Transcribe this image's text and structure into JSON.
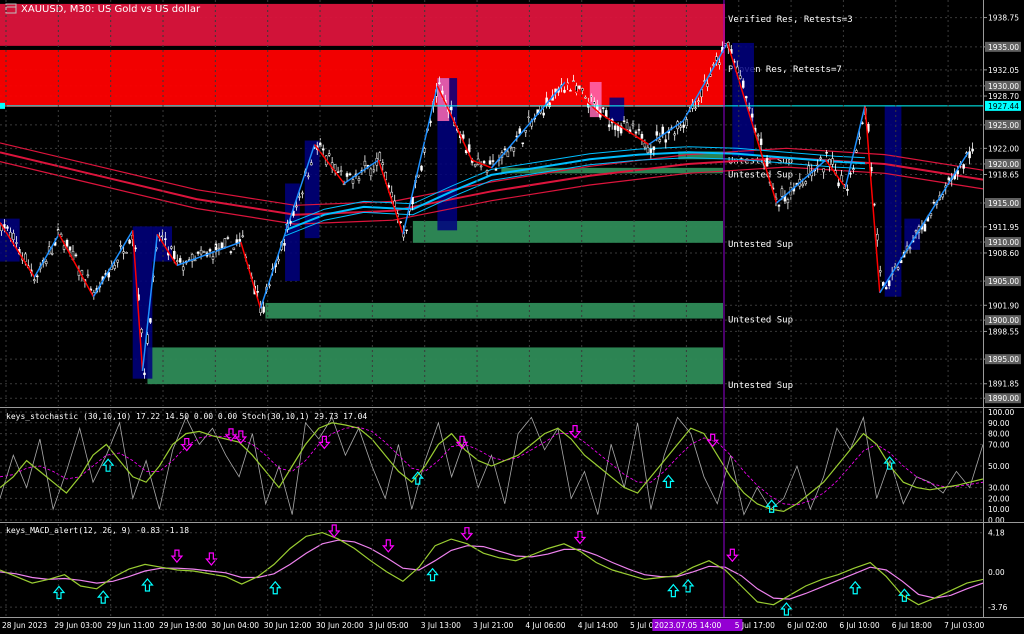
{
  "window": {
    "title": "XAUUSD, M30:  US Gold vs US dollar",
    "icon": "chart-window-icon"
  },
  "colors": {
    "background": "#000000",
    "grid": "#3a3a3a",
    "bull": "#ffffff",
    "bear": "#ffffff",
    "res_verified": "#dc143c",
    "res_proven": "#ff0000",
    "support_untested": "#2e8b57",
    "zigzag_up": "#1e90ff",
    "zigzag_down": "#ff0000",
    "ema_red": "#dc143c",
    "ema_blue": "#00bfff",
    "bid_line": "#00ffff",
    "period_separator": "#9400d3",
    "axis_text": "#ffffff",
    "stoch_main": "#9acd32",
    "stoch_signal": "#ff00ff",
    "stoch_fast": "#a9a9a9",
    "macd_main": "#9acd32",
    "macd_signal": "#ee82ee",
    "arrow_buy": "#00ffff",
    "arrow_sell": "#ff00ff"
  },
  "zones": {
    "labels": [
      "Verified Res, Retests=3",
      "Proven Res, Retests=7",
      "Untested Sup",
      "Untested Sup",
      "Untested Sup",
      "Untested Sup",
      "Untested Sup"
    ],
    "items": [
      {
        "kind": "verified_res",
        "label_index": 0,
        "low": 1935.0,
        "high": 1940.5,
        "x_from": 0.0,
        "x_to": 1.0
      },
      {
        "kind": "proven_res",
        "label_index": 1,
        "low": 1927.3,
        "high": 1934.6,
        "x_from": 0.0,
        "x_to": 1.0
      },
      {
        "kind": "untested_sup",
        "label_index": 2,
        "low": 1920.6,
        "high": 1921.6,
        "x_from": 0.69,
        "x_to": 1.0
      },
      {
        "kind": "untested_sup",
        "label_index": 3,
        "low": 1918.8,
        "high": 1919.5,
        "x_from": 0.51,
        "x_to": 1.0
      },
      {
        "kind": "untested_sup",
        "label_index": 4,
        "low": 1909.9,
        "high": 1912.7,
        "x_from": 0.42,
        "x_to": 1.0
      },
      {
        "kind": "untested_sup",
        "label_index": 5,
        "low": 1900.2,
        "high": 1902.2,
        "x_from": 0.27,
        "x_to": 1.0
      },
      {
        "kind": "untested_sup",
        "label_index": 6,
        "low": 1891.8,
        "high": 1896.5,
        "x_from": 0.15,
        "x_to": 1.0
      }
    ]
  },
  "chart_data": [
    {
      "type": "candlestick",
      "title": "XAUUSD, M30:  US Gold vs US dollar",
      "ylim": [
        1889.0,
        1941.0
      ],
      "y_tick_labels": [
        "1938.75",
        "1935.00",
        "1932.05",
        "1930.00",
        "1928.70",
        "1925.00",
        "1922.00",
        "1920.00",
        "1918.65",
        "1915.00",
        "1911.95",
        "1910.00",
        "1908.60",
        "1905.00",
        "1901.90",
        "1900.00",
        "1898.55",
        "1895.00",
        "1891.85",
        "1890.00"
      ],
      "current_price": 1927.44,
      "current_price_label": "1927.44",
      "x_labels": [
        "28 Jun 2023",
        "29 Jun 03:00",
        "29 Jun 11:00",
        "29 Jun 19:00",
        "30 Jun 04:00",
        "30 Jun 12:00",
        "30 Jun 20:00",
        "3 Jul 05:00",
        "3 Jul 13:00",
        "3 Jul 21:00",
        "4 Jul 06:00",
        "4 Jul 14:00",
        "5 Jul 01:00",
        "2023.07.05 14:00",
        "5 Jul 17:00",
        "6 Jul 02:00",
        "6 Jul 10:00",
        "6 Jul 18:00",
        "7 Jul 03:00"
      ],
      "highlighted_x_label_index": 13,
      "zigzag": [
        {
          "x": 0.0,
          "y": 1912.5
        },
        {
          "x": 0.035,
          "y": 1905.5
        },
        {
          "x": 0.06,
          "y": 1911.0
        },
        {
          "x": 0.095,
          "y": 1903.0
        },
        {
          "x": 0.135,
          "y": 1911.5
        },
        {
          "x": 0.145,
          "y": 1893.5
        },
        {
          "x": 0.16,
          "y": 1911.0
        },
        {
          "x": 0.18,
          "y": 1907.0
        },
        {
          "x": 0.245,
          "y": 1910.0
        },
        {
          "x": 0.265,
          "y": 1901.5
        },
        {
          "x": 0.32,
          "y": 1922.5
        },
        {
          "x": 0.35,
          "y": 1917.5
        },
        {
          "x": 0.385,
          "y": 1920.5
        },
        {
          "x": 0.41,
          "y": 1911.0
        },
        {
          "x": 0.445,
          "y": 1930.0
        },
        {
          "x": 0.48,
          "y": 1920.5
        },
        {
          "x": 0.5,
          "y": 1919.5
        },
        {
          "x": 0.575,
          "y": 1930.5
        },
        {
          "x": 0.61,
          "y": 1926.5
        },
        {
          "x": 0.66,
          "y": 1922.5
        },
        {
          "x": 0.695,
          "y": 1925.5
        },
        {
          "x": 0.74,
          "y": 1935.5
        },
        {
          "x": 0.79,
          "y": 1915.0
        },
        {
          "x": 0.84,
          "y": 1920.5
        },
        {
          "x": 0.86,
          "y": 1917.0
        },
        {
          "x": 0.88,
          "y": 1927.5
        },
        {
          "x": 0.895,
          "y": 1903.5
        },
        {
          "x": 0.985,
          "y": 1921.5
        }
      ],
      "ema_red": [
        {
          "x": 0.0,
          "y": 1921.5
        },
        {
          "x": 0.1,
          "y": 1918.5
        },
        {
          "x": 0.2,
          "y": 1915.5
        },
        {
          "x": 0.3,
          "y": 1913.5
        },
        {
          "x": 0.4,
          "y": 1914.0
        },
        {
          "x": 0.5,
          "y": 1916.5
        },
        {
          "x": 0.6,
          "y": 1918.5
        },
        {
          "x": 0.7,
          "y": 1920.0
        },
        {
          "x": 0.8,
          "y": 1920.8
        },
        {
          "x": 0.9,
          "y": 1920.0
        },
        {
          "x": 1.0,
          "y": 1918.0
        }
      ],
      "ema_blue": [
        {
          "x": 0.29,
          "y": 1911.5
        },
        {
          "x": 0.33,
          "y": 1913.5
        },
        {
          "x": 0.37,
          "y": 1914.5
        },
        {
          "x": 0.42,
          "y": 1914.2
        },
        {
          "x": 0.46,
          "y": 1916.5
        },
        {
          "x": 0.5,
          "y": 1918.6
        },
        {
          "x": 0.55,
          "y": 1919.6
        },
        {
          "x": 0.6,
          "y": 1920.6
        },
        {
          "x": 0.65,
          "y": 1921.2
        },
        {
          "x": 0.7,
          "y": 1921.5
        },
        {
          "x": 0.75,
          "y": 1921.3
        },
        {
          "x": 0.8,
          "y": 1920.8
        },
        {
          "x": 0.85,
          "y": 1920.3
        },
        {
          "x": 0.88,
          "y": 1920.1
        }
      ]
    },
    {
      "type": "line",
      "indicator_label": "keys_stochastic (30,10,10) 17.22 14.50 0.00 0.00 Stoch(30,10,1) 29.73 17.04",
      "ylim": [
        0,
        100
      ],
      "y_tick_labels": [
        "100.00",
        "90.00",
        "80.00",
        "70.00",
        "50.00",
        "30.00",
        "20.00",
        "10.00",
        "0.00"
      ],
      "series": [
        {
          "values": [
            30,
            40,
            55,
            45,
            35,
            25,
            40,
            60,
            70,
            55,
            40,
            35,
            50,
            70,
            80,
            82,
            78,
            75,
            72,
            60,
            45,
            30,
            50,
            70,
            85,
            90,
            88,
            85,
            75,
            60,
            45,
            35,
            50,
            70,
            80,
            65,
            55,
            50,
            55,
            60,
            70,
            80,
            85,
            75,
            60,
            50,
            40,
            30,
            25,
            40,
            55,
            70,
            85,
            80,
            60,
            40,
            25,
            15,
            10,
            8,
            15,
            25,
            35,
            50,
            65,
            80,
            70,
            50,
            35,
            30,
            28,
            30,
            32,
            35,
            38
          ]
        },
        {
          "values": [
            40,
            42,
            48,
            50,
            45,
            38,
            40,
            50,
            60,
            62,
            55,
            45,
            45,
            55,
            68,
            76,
            78,
            77,
            75,
            70,
            60,
            48,
            45,
            55,
            70,
            80,
            85,
            86,
            82,
            72,
            60,
            48,
            45,
            55,
            68,
            70,
            65,
            58,
            55,
            58,
            65,
            72,
            80,
            80,
            72,
            62,
            52,
            42,
            35,
            35,
            45,
            58,
            70,
            76,
            72,
            60,
            45,
            32,
            22,
            15,
            14,
            18,
            25,
            36,
            50,
            64,
            70,
            62,
            50,
            40,
            34,
            31,
            31,
            33,
            35
          ]
        },
        {
          "values": [
            20,
            60,
            30,
            75,
            10,
            45,
            85,
            35,
            60,
            90,
            20,
            55,
            10,
            65,
            95,
            70,
            85,
            60,
            40,
            80,
            15,
            50,
            5,
            90,
            75,
            95,
            60,
            85,
            50,
            20,
            70,
            10,
            55,
            90,
            40,
            75,
            30,
            60,
            15,
            80,
            95,
            65,
            85,
            20,
            45,
            5,
            70,
            30,
            90,
            10,
            60,
            95,
            80,
            40,
            15,
            60,
            5,
            30,
            10,
            20,
            50,
            10,
            40,
            85,
            65,
            95,
            20,
            55,
            15,
            40,
            35,
            25,
            45,
            30,
            70
          ]
        }
      ],
      "buy_arrows": [
        0.11,
        0.425,
        0.68,
        0.785,
        0.905
      ],
      "sell_arrows": [
        0.19,
        0.235,
        0.245,
        0.33,
        0.47,
        0.585,
        0.725
      ]
    },
    {
      "type": "line",
      "indicator_label": "keys_MACD_alert(12, 26, 9) -0.83 -1.18",
      "ylim": [
        -4.6,
        4.9
      ],
      "y_tick_labels": [
        "4.18",
        "0.00",
        "-3.76"
      ],
      "series": [
        {
          "values": [
            0.2,
            -0.5,
            -1.2,
            -0.8,
            -0.3,
            -1.5,
            -1.8,
            -0.6,
            0.3,
            0.8,
            0.5,
            0.2,
            0.1,
            -0.2,
            -0.5,
            -1.3,
            -0.5,
            0.8,
            2.5,
            3.8,
            4.2,
            3.5,
            2.5,
            1.2,
            0.0,
            -1.0,
            0.5,
            2.8,
            3.5,
            3.0,
            2.0,
            1.5,
            1.2,
            1.8,
            2.5,
            3.0,
            2.2,
            1.0,
            0.2,
            -0.3,
            -0.8,
            -0.6,
            -0.4,
            0.5,
            1.2,
            0.2,
            -1.5,
            -3.2,
            -3.5,
            -2.5,
            -1.5,
            -0.8,
            -0.3,
            0.4,
            1.0,
            -0.5,
            -2.5,
            -3.5,
            -2.8,
            -2.0,
            -1.2,
            -0.8
          ]
        },
        {
          "values": [
            0.0,
            -0.2,
            -0.6,
            -0.8,
            -0.7,
            -0.9,
            -1.2,
            -1.0,
            -0.5,
            0.1,
            0.4,
            0.4,
            0.3,
            0.1,
            -0.1,
            -0.6,
            -0.6,
            -0.2,
            0.8,
            2.0,
            3.0,
            3.4,
            3.2,
            2.5,
            1.5,
            0.4,
            0.2,
            1.2,
            2.3,
            2.8,
            2.7,
            2.2,
            1.7,
            1.6,
            1.9,
            2.4,
            2.4,
            1.8,
            1.0,
            0.3,
            -0.3,
            -0.5,
            -0.5,
            0.0,
            0.6,
            0.5,
            -0.4,
            -1.8,
            -2.8,
            -2.9,
            -2.3,
            -1.6,
            -0.9,
            -0.2,
            0.5,
            0.2,
            -1.0,
            -2.4,
            -2.8,
            -2.5,
            -1.8,
            -1.2
          ]
        }
      ],
      "buy_arrows": [
        0.06,
        0.105,
        0.15,
        0.28,
        0.44,
        0.685,
        0.7,
        0.8,
        0.87,
        0.92
      ],
      "sell_arrows": [
        0.18,
        0.215,
        0.34,
        0.395,
        0.475,
        0.59,
        0.745
      ]
    }
  ]
}
